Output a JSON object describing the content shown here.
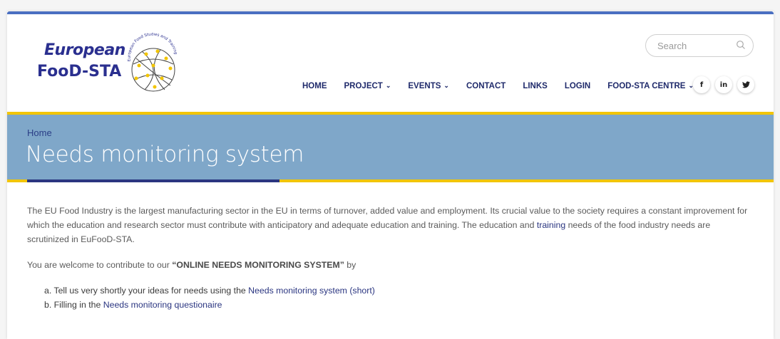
{
  "logo": {
    "line1": "European",
    "line2": "FooD-STA",
    "arc_text": "European Food Studies and Training Alliance"
  },
  "search": {
    "placeholder": "Search"
  },
  "nav": {
    "items": [
      {
        "label": "HOME",
        "dropdown": false
      },
      {
        "label": "PROJECT",
        "dropdown": true
      },
      {
        "label": "EVENTS",
        "dropdown": true
      },
      {
        "label": "CONTACT",
        "dropdown": false
      },
      {
        "label": "LINKS",
        "dropdown": false
      },
      {
        "label": "LOGIN",
        "dropdown": false
      },
      {
        "label": "FOOD-STA CENTRE",
        "dropdown": true
      }
    ],
    "chevron": "⌄"
  },
  "social": {
    "facebook": "f",
    "linkedin": "in",
    "twitter": "🐦"
  },
  "banner": {
    "breadcrumb": "Home",
    "title": "Needs monitoring system"
  },
  "content": {
    "para1_a": "The EU Food Industry is the largest manufacturing sector in the EU in terms of turnover, added value and employment. Its crucial value to the society requires a constant improvement for which the education and research sector must contribute with anticipatory and adequate education and training. The education and ",
    "para1_link": "training",
    "para1_b": " needs of the food industry needs are scrutinized in EuFooD-STA.",
    "para2_a": "You are welcome to contribute to our ",
    "para2_strong": "“ONLINE NEEDS MONITORING SYSTEM”",
    "para2_b": " by",
    "list": [
      {
        "prefix": "a. Tell us very shortly your ideas for needs using the ",
        "link": "Needs monitoring system (short)"
      },
      {
        "prefix": "b. Filling in the ",
        "link": "Needs monitoring questionaire"
      }
    ]
  },
  "colors": {
    "accent_blue": "#4a6fc1",
    "banner": "#7fa7c9",
    "gold": "#f2c500",
    "navy": "#2b3580"
  }
}
